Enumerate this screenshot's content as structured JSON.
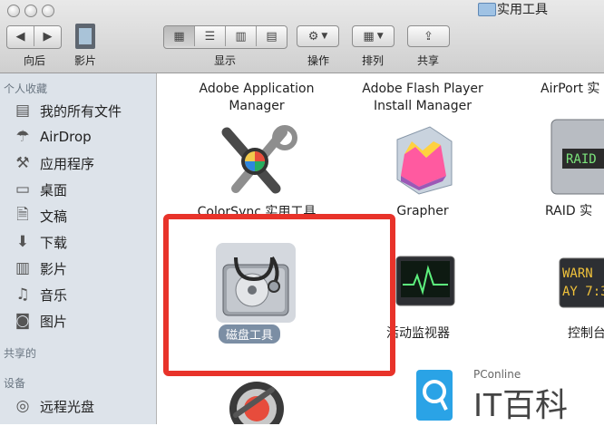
{
  "window": {
    "title": "实用工具"
  },
  "toolbar": {
    "back_label": "向后",
    "coverflow_label": "影片",
    "view_label": "显示",
    "action_label": "操作",
    "arrange_label": "排列",
    "share_label": "共享"
  },
  "sidebar": {
    "favorites_header": "个人收藏",
    "shared_header": "共享的",
    "devices_header": "设备",
    "items": [
      {
        "label": "我的所有文件",
        "icon": "all-files-icon"
      },
      {
        "label": "AirDrop",
        "icon": "airdrop-icon"
      },
      {
        "label": "应用程序",
        "icon": "applications-icon"
      },
      {
        "label": "桌面",
        "icon": "desktop-icon"
      },
      {
        "label": "文稿",
        "icon": "documents-icon"
      },
      {
        "label": "下载",
        "icon": "downloads-icon"
      },
      {
        "label": "影片",
        "icon": "movies-icon"
      },
      {
        "label": "音乐",
        "icon": "music-icon"
      },
      {
        "label": "图片",
        "icon": "pictures-icon"
      }
    ],
    "device_items": [
      {
        "label": "远程光盘",
        "icon": "remote-disc-icon"
      }
    ]
  },
  "apps": {
    "app1_line1": "Adobe Application",
    "app1_line2": "Manager",
    "app2_line1": "Adobe Flash Player",
    "app2_line2": "Install Manager",
    "app3": "AirPort 实",
    "app4": "ColorSync 实用工具",
    "app5": "Grapher",
    "app6": "RAID 实",
    "app7": "磁盘工具",
    "app8": "活动监视器",
    "app9": "控制台"
  },
  "watermark": {
    "brand": "PConline",
    "text": "IT百科"
  },
  "colors": {
    "highlight": "#e8332a",
    "sidebar_bg": "#dde3ea",
    "selection": "#7b8ea4"
  }
}
